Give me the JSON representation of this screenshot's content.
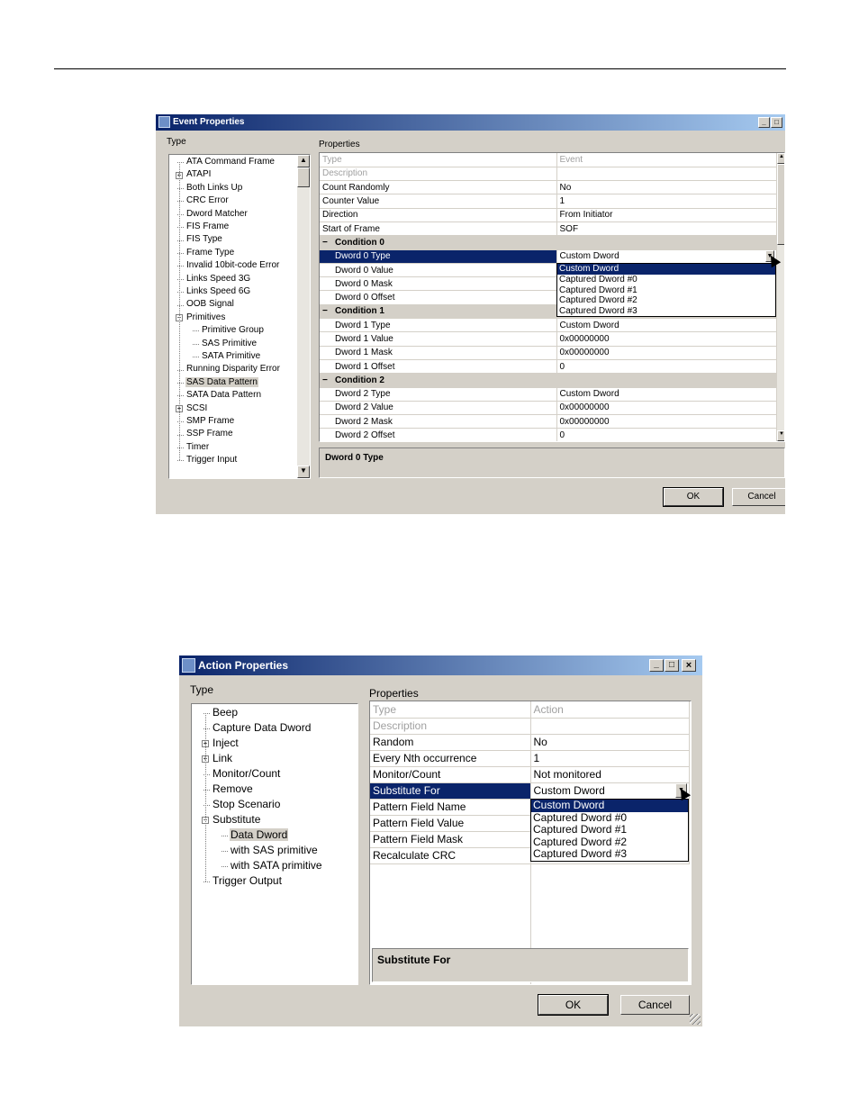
{
  "event_dialog": {
    "title": "Event Properties",
    "type_label": "Type",
    "properties_label": "Properties",
    "tree": [
      {
        "label": "ATA Command Frame",
        "level": 0,
        "expander": false
      },
      {
        "label": "ATAPI",
        "level": 0,
        "expander": true
      },
      {
        "label": "Both Links Up",
        "level": 0,
        "expander": false
      },
      {
        "label": "CRC Error",
        "level": 0,
        "expander": false
      },
      {
        "label": "Dword Matcher",
        "level": 0,
        "expander": false
      },
      {
        "label": "FIS Frame",
        "level": 0,
        "expander": false
      },
      {
        "label": "FIS Type",
        "level": 0,
        "expander": false
      },
      {
        "label": "Frame Type",
        "level": 0,
        "expander": false
      },
      {
        "label": "Invalid 10bit-code Error",
        "level": 0,
        "expander": false
      },
      {
        "label": "Links Speed 3G",
        "level": 0,
        "expander": false
      },
      {
        "label": "Links Speed 6G",
        "level": 0,
        "expander": false
      },
      {
        "label": "OOB Signal",
        "level": 0,
        "expander": false
      },
      {
        "label": "Primitives",
        "level": 0,
        "expander": true,
        "expanded": true
      },
      {
        "label": "Primitive Group",
        "level": 1,
        "expander": false
      },
      {
        "label": "SAS Primitive",
        "level": 1,
        "expander": false
      },
      {
        "label": "SATA Primitive",
        "level": 1,
        "expander": false
      },
      {
        "label": "Running Disparity Error",
        "level": 0,
        "expander": false
      },
      {
        "label": "SAS Data Pattern",
        "level": 0,
        "expander": false,
        "selected": true
      },
      {
        "label": "SATA Data Pattern",
        "level": 0,
        "expander": false
      },
      {
        "label": "SCSI",
        "level": 0,
        "expander": true
      },
      {
        "label": "SMP Frame",
        "level": 0,
        "expander": false
      },
      {
        "label": "SSP Frame",
        "level": 0,
        "expander": false
      },
      {
        "label": "Timer",
        "level": 0,
        "expander": false
      },
      {
        "label": "Trigger Input",
        "level": 0,
        "expander": false
      }
    ],
    "rows": [
      {
        "kind": "prop",
        "name": "Type",
        "value": "Event",
        "gray": true
      },
      {
        "kind": "prop",
        "name": "Description",
        "value": "",
        "gray": true
      },
      {
        "kind": "prop",
        "name": "Count Randomly",
        "value": "No"
      },
      {
        "kind": "prop",
        "name": "Counter Value",
        "value": "1"
      },
      {
        "kind": "prop",
        "name": "Direction",
        "value": "From Initiator"
      },
      {
        "kind": "prop",
        "name": "Start of Frame",
        "value": "SOF"
      },
      {
        "kind": "cat",
        "name": "Condition 0"
      },
      {
        "kind": "prop",
        "name": "Dword 0 Type",
        "value": "Custom Dword",
        "indent": true,
        "selected": true
      },
      {
        "kind": "prop",
        "name": "Dword 0 Value",
        "value": "",
        "indent": true
      },
      {
        "kind": "prop",
        "name": "Dword 0 Mask",
        "value": "",
        "indent": true
      },
      {
        "kind": "prop",
        "name": "Dword 0 Offset",
        "value": "",
        "indent": true
      },
      {
        "kind": "cat",
        "name": "Condition 1"
      },
      {
        "kind": "prop",
        "name": "Dword 1 Type",
        "value": "Custom Dword",
        "indent": true
      },
      {
        "kind": "prop",
        "name": "Dword 1 Value",
        "value": "0x00000000",
        "indent": true
      },
      {
        "kind": "prop",
        "name": "Dword 1 Mask",
        "value": "0x00000000",
        "indent": true
      },
      {
        "kind": "prop",
        "name": "Dword 1 Offset",
        "value": "0",
        "indent": true
      },
      {
        "kind": "cat",
        "name": "Condition 2"
      },
      {
        "kind": "prop",
        "name": "Dword 2 Type",
        "value": "Custom Dword",
        "indent": true
      },
      {
        "kind": "prop",
        "name": "Dword 2 Value",
        "value": "0x00000000",
        "indent": true
      },
      {
        "kind": "prop",
        "name": "Dword 2 Mask",
        "value": "0x00000000",
        "indent": true
      },
      {
        "kind": "prop",
        "name": "Dword 2 Offset",
        "value": "0",
        "indent": true
      }
    ],
    "dropdown_options": [
      "Custom Dword",
      "Captured Dword #0",
      "Captured Dword #1",
      "Captured Dword #2",
      "Captured Dword #3"
    ],
    "description_title": "Dword 0 Type",
    "ok_label": "OK",
    "cancel_label": "Cancel"
  },
  "action_dialog": {
    "title": "Action Properties",
    "type_label": "Type",
    "properties_label": "Properties",
    "tree": [
      {
        "label": "Beep",
        "level": 0,
        "expander": false
      },
      {
        "label": "Capture Data Dword",
        "level": 0,
        "expander": false
      },
      {
        "label": "Inject",
        "level": 0,
        "expander": true
      },
      {
        "label": "Link",
        "level": 0,
        "expander": true
      },
      {
        "label": "Monitor/Count",
        "level": 0,
        "expander": false
      },
      {
        "label": "Remove",
        "level": 0,
        "expander": false
      },
      {
        "label": "Stop Scenario",
        "level": 0,
        "expander": false
      },
      {
        "label": "Substitute",
        "level": 0,
        "expander": true,
        "expanded": true
      },
      {
        "label": "Data Dword",
        "level": 1,
        "expander": false,
        "selected": true
      },
      {
        "label": "with SAS primitive",
        "level": 1,
        "expander": false
      },
      {
        "label": "with SATA primitive",
        "level": 1,
        "expander": false
      },
      {
        "label": "Trigger Output",
        "level": 0,
        "expander": false
      }
    ],
    "rows": [
      {
        "kind": "prop",
        "name": "Type",
        "value": "Action",
        "gray": true
      },
      {
        "kind": "prop",
        "name": "Description",
        "value": "",
        "gray": true
      },
      {
        "kind": "prop",
        "name": "Random",
        "value": "No"
      },
      {
        "kind": "prop",
        "name": "Every Nth occurrence",
        "value": "1"
      },
      {
        "kind": "prop",
        "name": "Monitor/Count",
        "value": "Not monitored"
      },
      {
        "kind": "prop",
        "name": "Substitute For",
        "value": "Custom Dword",
        "selected": true
      },
      {
        "kind": "prop",
        "name": "Pattern Field Name",
        "value": ""
      },
      {
        "kind": "prop",
        "name": "Pattern Field Value",
        "value": ""
      },
      {
        "kind": "prop",
        "name": "Pattern Field Mask",
        "value": ""
      },
      {
        "kind": "prop",
        "name": "Recalculate CRC",
        "value": ""
      }
    ],
    "dropdown_options": [
      "Custom Dword",
      "Captured Dword #0",
      "Captured Dword #1",
      "Captured Dword #2",
      "Captured Dword #3"
    ],
    "description_title": "Substitute For",
    "ok_label": "OK",
    "cancel_label": "Cancel"
  },
  "icons": {
    "minimize": "minimize-icon",
    "maximize": "maximize-icon",
    "close": "close-icon",
    "expander_plus": "+",
    "expander_minus": "−",
    "scroll_up": "▲",
    "scroll_down": "▼",
    "dropdown_arrow": "▼"
  }
}
